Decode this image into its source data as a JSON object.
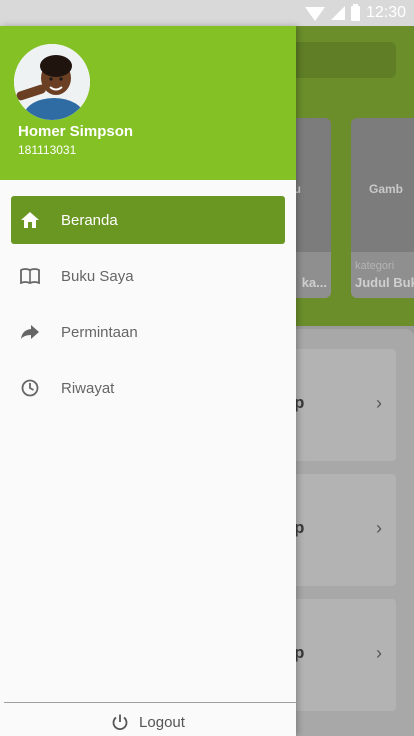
{
  "status": {
    "time": "12:30"
  },
  "background": {
    "cards": [
      {
        "title": "u",
        "category": "",
        "book": "ka..."
      },
      {
        "title": "Gamb",
        "category": "kategori",
        "book": "Judul Buk"
      }
    ],
    "rows": [
      "p",
      "p",
      "p"
    ]
  },
  "drawer": {
    "user": {
      "name": "Homer Simpson",
      "id": "181113031"
    },
    "menu": [
      {
        "label": "Beranda",
        "icon": "home-icon"
      },
      {
        "label": "Buku Saya",
        "icon": "book-icon"
      },
      {
        "label": "Permintaan",
        "icon": "share-arrow-icon"
      },
      {
        "label": "Riwayat",
        "icon": "clock-icon"
      }
    ],
    "logout_label": "Logout"
  },
  "colors": {
    "drawer_header": "#83c125",
    "active_item": "#6a9622"
  }
}
